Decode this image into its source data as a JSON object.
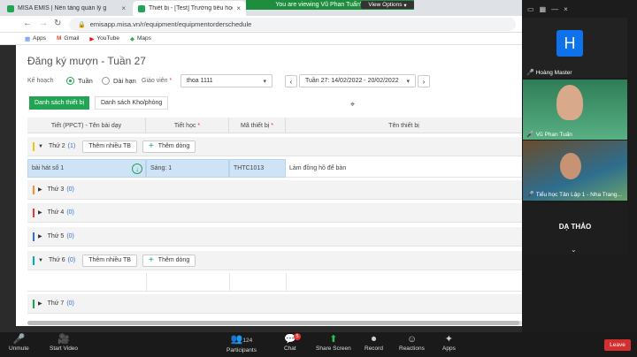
{
  "browser": {
    "tabs": [
      {
        "label": "MISA EMIS | Nền tảng quản lý gi",
        "close": "×"
      },
      {
        "label": "Thiết bị - [Test] Trường tiểu học l",
        "close": "×"
      }
    ],
    "url": "emisapp.misa.vn/r/equipment/equipmentorderschedule",
    "bookmarks": [
      "Apps",
      "Gmail",
      "YouTube",
      "Maps"
    ]
  },
  "share_banner": {
    "text": "You are viewing Vũ Phan Tuấn's screen",
    "view_options": "View Options"
  },
  "page": {
    "title": "Đăng ký mượn - Tuần 27",
    "plan_label": "Kế hoạch",
    "radio_week": "Tuần",
    "radio_long": "Dài hạn",
    "teacher_label": "Giáo viên",
    "teacher_value": "thoa 1111",
    "week_value": "Tuần 27: 14/02/2022 - 20/02/2022",
    "tab_devices": "Danh sách thiết bị",
    "tab_rooms": "Danh sách Kho/phòng"
  },
  "table": {
    "headers": [
      "Tiết (PPCT) - Tên bài dạy",
      "Tiết học",
      "Mã thiết bị",
      "Tên thiết bị"
    ],
    "add_many": "Thêm nhiều TB",
    "add_row": "Thêm dòng",
    "groups": [
      {
        "name": "Thứ 2",
        "count": "(1)"
      },
      {
        "name": "Thứ 3",
        "count": "(0)"
      },
      {
        "name": "Thứ 4",
        "count": "(0)"
      },
      {
        "name": "Thứ 5",
        "count": "(0)"
      },
      {
        "name": "Thứ 6",
        "count": "(0)"
      },
      {
        "name": "Thứ 7",
        "count": "(0)"
      }
    ],
    "row": {
      "lesson": "bài hát số 1",
      "period": "Sáng: 1",
      "code": "THTC1013",
      "device": "Làm đồng hồ để bàn"
    }
  },
  "zoom": {
    "participants": [
      {
        "name": "Hoàng Master",
        "initial": "H"
      },
      {
        "name": "Vũ Phan Tuấn"
      },
      {
        "name": "Tiểu học Tân Lập 1 - Nha Trang..."
      },
      {
        "name": "DẠ THẢO"
      }
    ],
    "toolbar": {
      "unmute": "Unmute",
      "start_video": "Start Video",
      "participants": "Participants",
      "participants_count": "124",
      "chat": "Chat",
      "chat_badge": "5",
      "share": "Share Screen",
      "record": "Record",
      "reactions": "Reactions",
      "apps": "Apps",
      "leave": "Leave"
    }
  },
  "colors": {
    "accent": "#23a455",
    "leave": "#d32f2f",
    "link": "#2f6fd0"
  }
}
